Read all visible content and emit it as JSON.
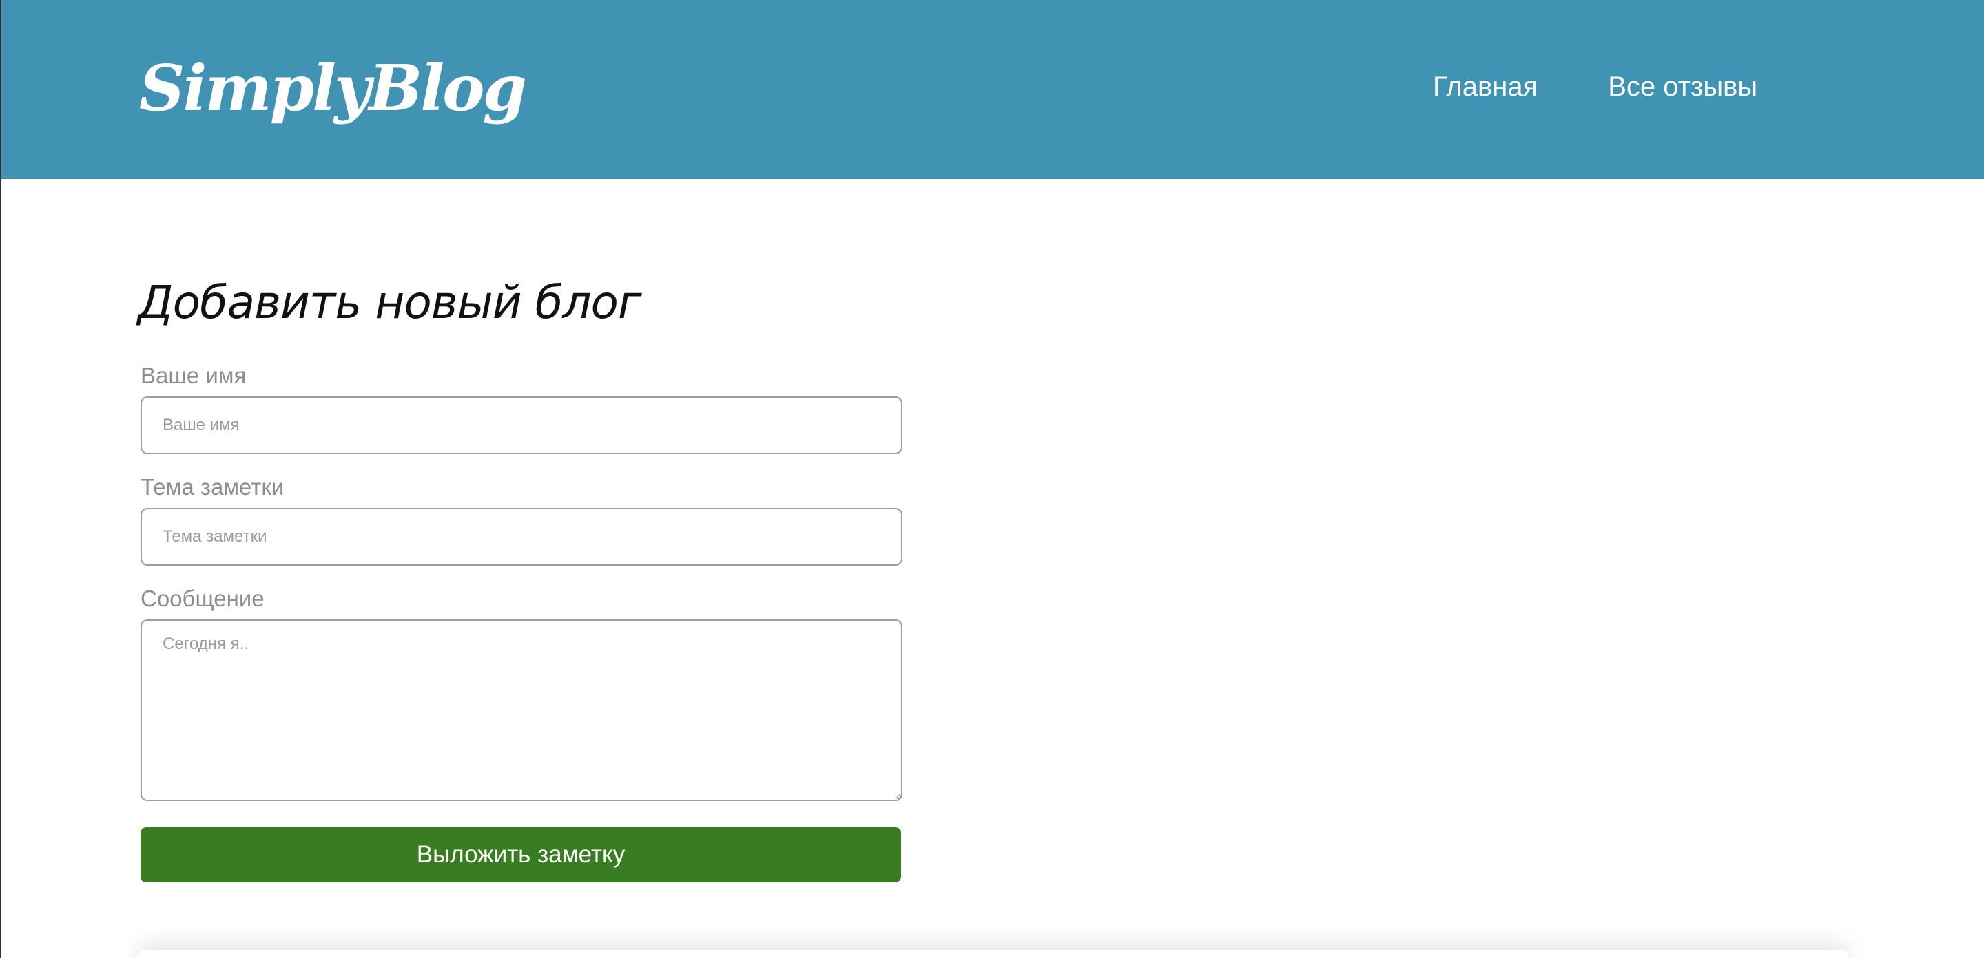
{
  "header": {
    "logo": "SimplyBlog",
    "nav": [
      {
        "label": "Главная"
      },
      {
        "label": "Все отзывы"
      }
    ]
  },
  "form": {
    "title": "Добавить новый блог",
    "name_label": "Ваше имя",
    "name_placeholder": "Ваше имя",
    "name_value": "",
    "topic_label": "Тема заметки",
    "topic_placeholder": "Тема заметки",
    "topic_value": "",
    "message_label": "Сообщение",
    "message_placeholder": "Сегодня я..",
    "message_value": "",
    "submit_label": "Выложить заметку"
  },
  "colors": {
    "header_bg": "#4193b3",
    "submit_bg": "#387d21",
    "label_text": "#8e8e8e"
  }
}
